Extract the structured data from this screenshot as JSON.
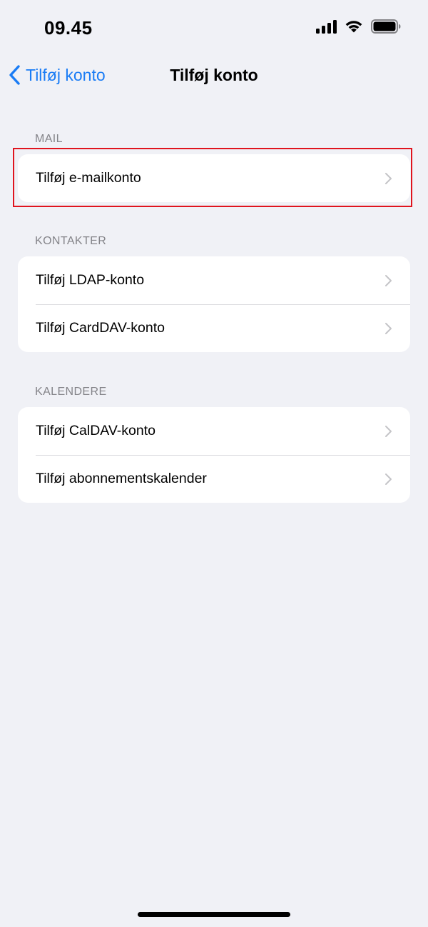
{
  "status_bar": {
    "time": "09.45"
  },
  "nav": {
    "back_label": "Tilføj konto",
    "title": "Tilføj konto"
  },
  "sections": [
    {
      "header": "MAIL",
      "items": [
        {
          "label": "Tilføj e-mailkonto"
        }
      ]
    },
    {
      "header": "KONTAKTER",
      "items": [
        {
          "label": "Tilføj LDAP-konto"
        },
        {
          "label": "Tilføj CardDAV-konto"
        }
      ]
    },
    {
      "header": "KALENDERE",
      "items": [
        {
          "label": "Tilføj CalDAV-konto"
        },
        {
          "label": "Tilføj abonnementskalender"
        }
      ]
    }
  ],
  "colors": {
    "accent": "#1a7cf5",
    "background": "#f0f1f6",
    "highlight": "#e0141e"
  }
}
